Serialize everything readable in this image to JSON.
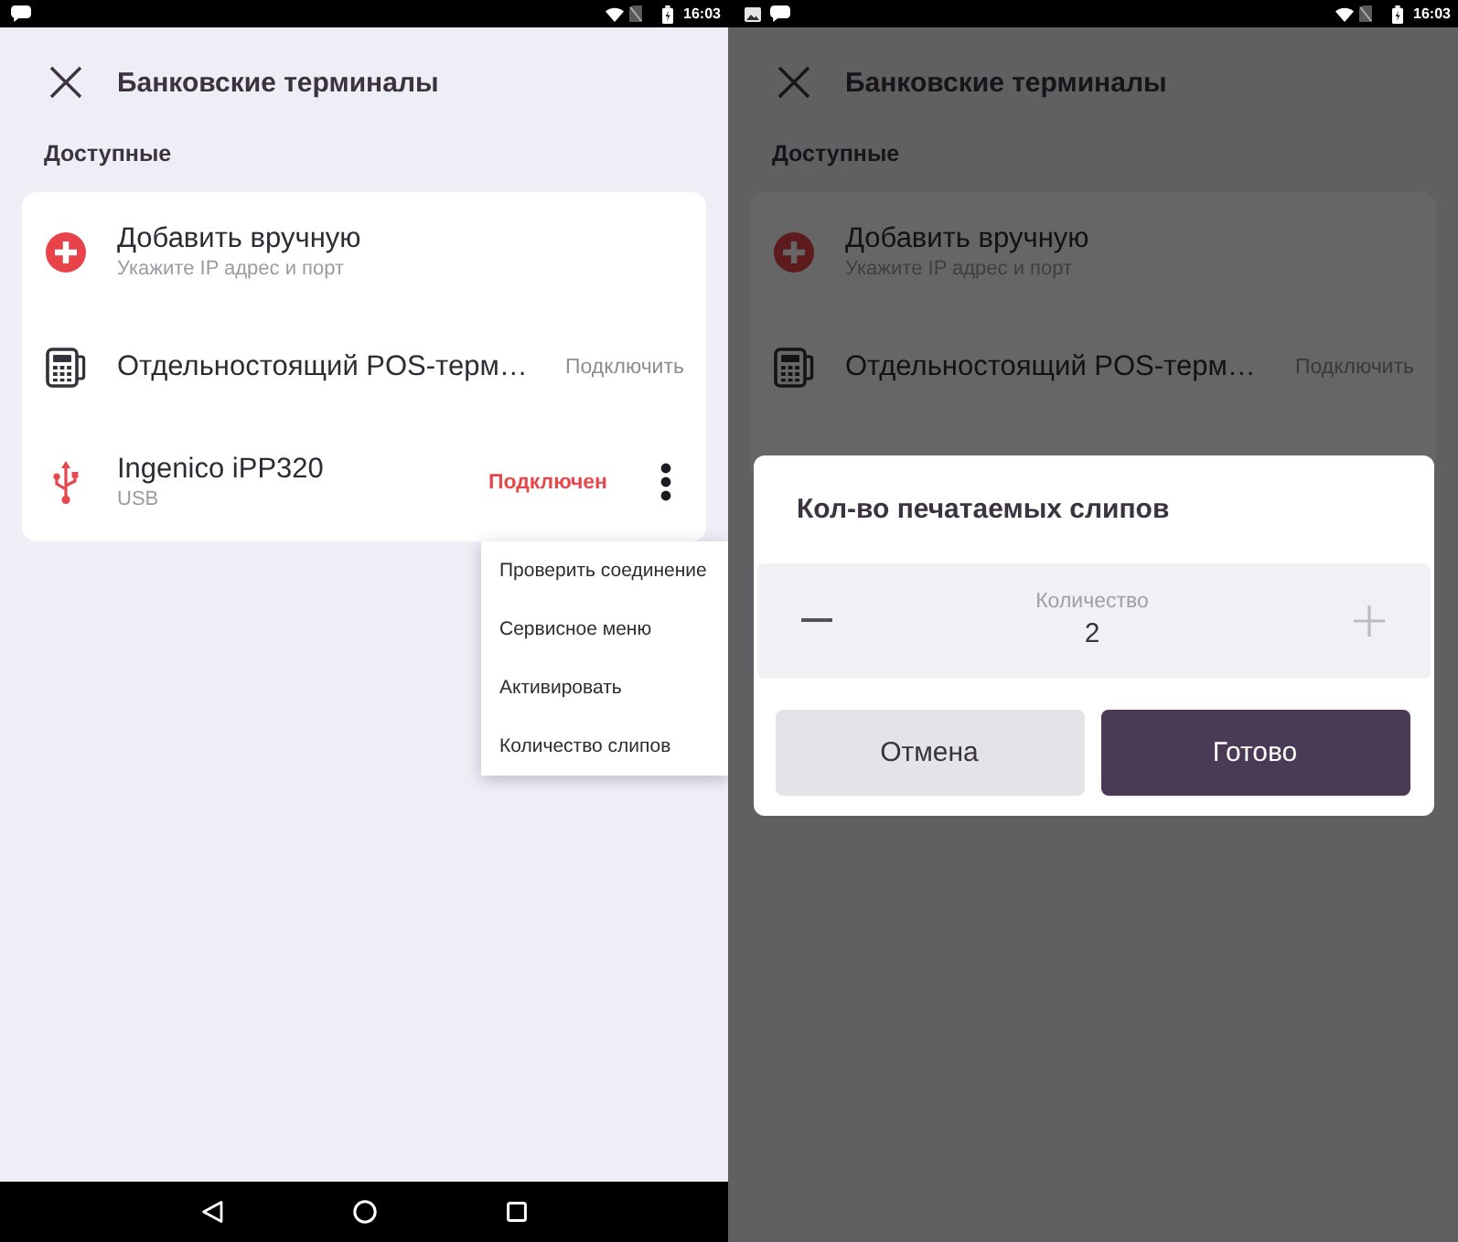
{
  "screens": [
    {
      "status_bar": {
        "notifications": [
          {
            "kind": "message"
          }
        ],
        "time": "16:03"
      },
      "dimmed": false,
      "header": {
        "title": "Банковские терминалы"
      },
      "section_title": "Доступные",
      "terminals": [
        {
          "kind": "add",
          "title": "Добавить вручную",
          "subtitle": "Укажите IP адрес и порт",
          "more_button": false
        },
        {
          "kind": "pos",
          "title": "Отдельностоящий POS-терм…",
          "action": "Подключить",
          "more_button": false
        },
        {
          "kind": "usb",
          "title": "Ingenico iPP320",
          "subtitle": "USB",
          "status": "Подключен",
          "more_button": true
        }
      ],
      "context_menu": {
        "items": [
          "Проверить соединение",
          "Сервисное меню",
          "Активировать",
          "Количество слипов"
        ]
      },
      "nav_bar": true
    },
    {
      "status_bar": {
        "notifications": [
          {
            "kind": "image"
          },
          {
            "kind": "message"
          }
        ],
        "time": "16:03"
      },
      "dimmed": true,
      "header": {
        "title": "Банковские терминалы"
      },
      "section_title": "Доступные",
      "terminals": [
        {
          "kind": "add",
          "title": "Добавить вручную",
          "subtitle": "Укажите IP адрес и порт",
          "more_button": false
        },
        {
          "kind": "pos",
          "title": "Отдельностоящий POS-терм…",
          "action": "Подключить",
          "more_button": false
        }
      ],
      "dialog": {
        "title": "Кол-во печатаемых слипов",
        "stepper": {
          "label": "Количество",
          "value": "2",
          "decrease": {
            "disabled": false
          },
          "increase": {
            "disabled": true
          }
        },
        "buttons": [
          {
            "kind": "cancel",
            "label": "Отмена"
          },
          {
            "kind": "confirm",
            "label": "Готово"
          }
        ]
      },
      "nav_bar": false
    }
  ]
}
